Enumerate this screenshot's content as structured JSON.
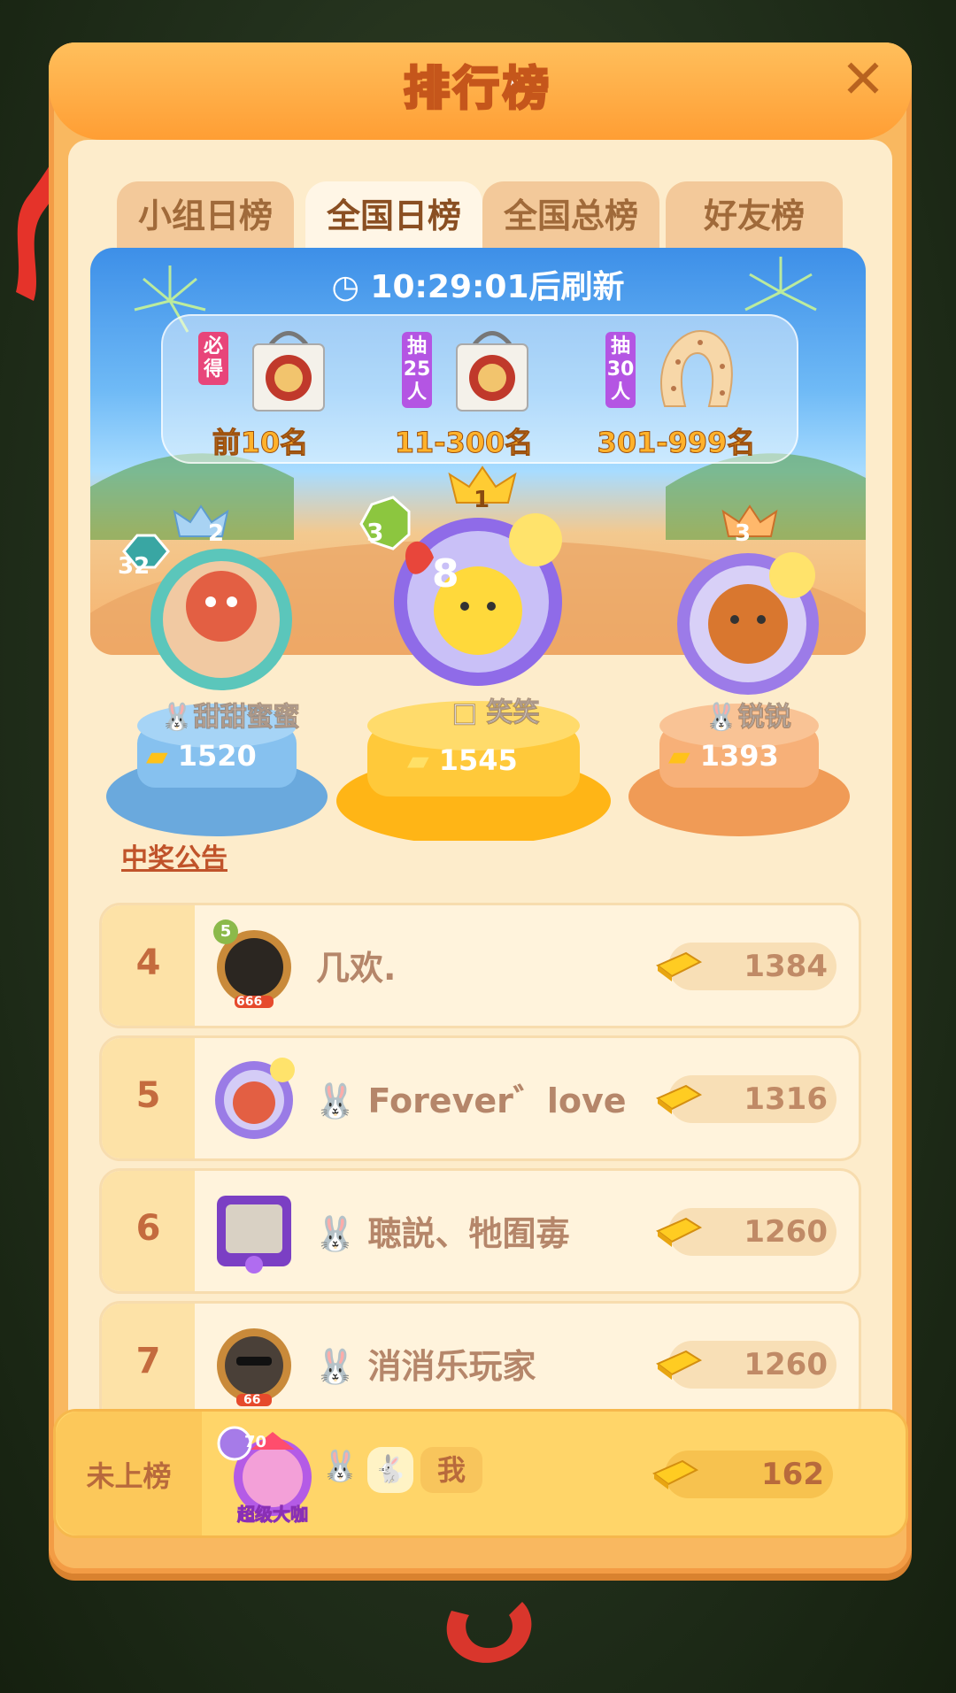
{
  "header": {
    "title": "排行榜"
  },
  "tabs": [
    {
      "label": "小组日榜",
      "active": false
    },
    {
      "label": "全国日榜",
      "active": true
    },
    {
      "label": "全国总榜",
      "active": false
    },
    {
      "label": "好友榜",
      "active": false
    }
  ],
  "banner": {
    "timer": "10:29:01后刷新",
    "rewards": [
      {
        "tag": "必得",
        "range": "前10名",
        "item": "tote-bag"
      },
      {
        "tag": "抽25人",
        "range": "11-300名",
        "item": "tote-bag"
      },
      {
        "tag": "抽30人",
        "range": "301-999名",
        "item": "neck-pillow"
      }
    ]
  },
  "podium": [
    {
      "place": "2",
      "level": "32",
      "name": "甜甜蜜蜜",
      "score": "1520"
    },
    {
      "place": "1",
      "level": "3",
      "badge": "8",
      "name": "笑笑",
      "score": "1545"
    },
    {
      "place": "3",
      "name": "锐锐",
      "score": "1393"
    }
  ],
  "announcement_link": "中奖公告",
  "list": [
    {
      "rank": "4",
      "level": "5",
      "avatar_badge": "666",
      "name": "几欢.",
      "score": "1384"
    },
    {
      "rank": "5",
      "name": "Forever゛love",
      "score": "1316"
    },
    {
      "rank": "6",
      "name": "聴説、牠囿毐",
      "score": "1260"
    },
    {
      "rank": "7",
      "avatar_badge": "66",
      "name": "消消乐玩家",
      "score": "1260"
    }
  ],
  "me": {
    "rank": "未上榜",
    "level": "70",
    "title": "超级大咖",
    "name": "我",
    "score": "162"
  },
  "colors": {
    "accent": "#ff9e34",
    "title_stroke": "#c5561b",
    "rank_text": "#c46b3e"
  }
}
